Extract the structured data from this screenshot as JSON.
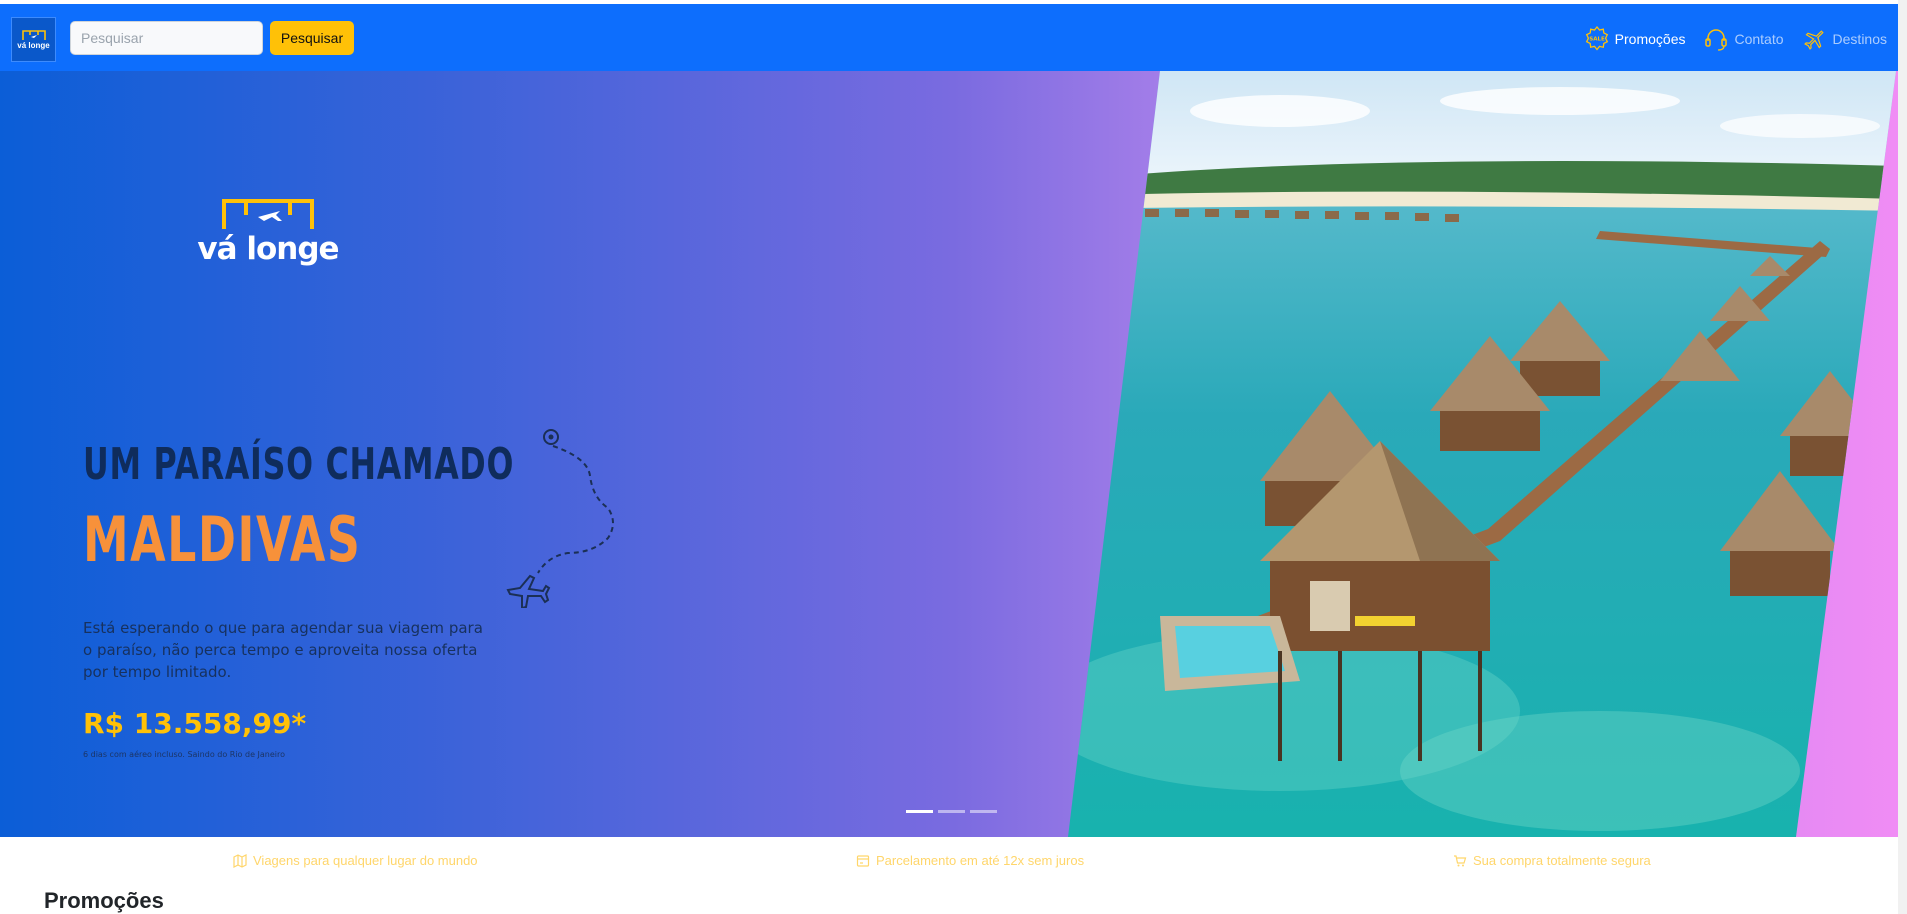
{
  "navbar": {
    "brand_logo_text": "vá longe",
    "search_placeholder": "Pesquisar",
    "search_button": "Pesquisar",
    "links": [
      {
        "label": "Promoções",
        "icon": "sale-badge-icon",
        "active": true
      },
      {
        "label": "Contato",
        "icon": "headset-icon",
        "active": false
      },
      {
        "label": "Destinos",
        "icon": "airplane-icon",
        "active": false
      }
    ]
  },
  "hero": {
    "logo_text": "vá longe",
    "title_line1": "UM PARAÍSO CHAMADO",
    "title_line2": "MALDIVAS",
    "description": "Está esperando o que para agendar sua viagem para o paraíso, não perca tempo e aproveita nossa oferta por tempo limitado.",
    "price": "R$ 13.558,99*",
    "price_note": "6 dias com aéreo incluso. Saindo do Rio de Janeiro",
    "slide_count": 3,
    "active_slide": 1
  },
  "features": [
    {
      "label": "Viagens para qualquer lugar do mundo",
      "icon": "map-icon"
    },
    {
      "label": "Parcelamento em até 12x sem juros",
      "icon": "payment-icon"
    },
    {
      "label": "Sua compra totalmente segura",
      "icon": "secure-cart-icon"
    }
  ],
  "section": {
    "title": "Promoções"
  },
  "colors": {
    "navbar": "#0d6efd",
    "accent": "#ffc107",
    "title_orange": "#f7913a",
    "title_dark": "#0f2c5c"
  }
}
